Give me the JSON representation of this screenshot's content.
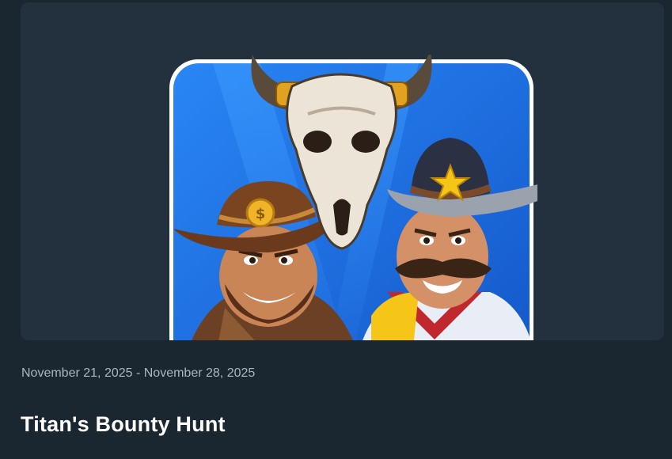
{
  "event": {
    "date_range": "November 21, 2025 - November 28, 2025",
    "title": "Titan's Bounty Hunt"
  },
  "hero": {
    "image": "game-artwork-cowboys-and-bull-skull",
    "background_color": "#22313d",
    "tile_color": "#1f6fe0"
  },
  "theme": {
    "page_background": "#1b2730",
    "date_color": "#a9b5c1",
    "title_color": "#ffffff"
  }
}
